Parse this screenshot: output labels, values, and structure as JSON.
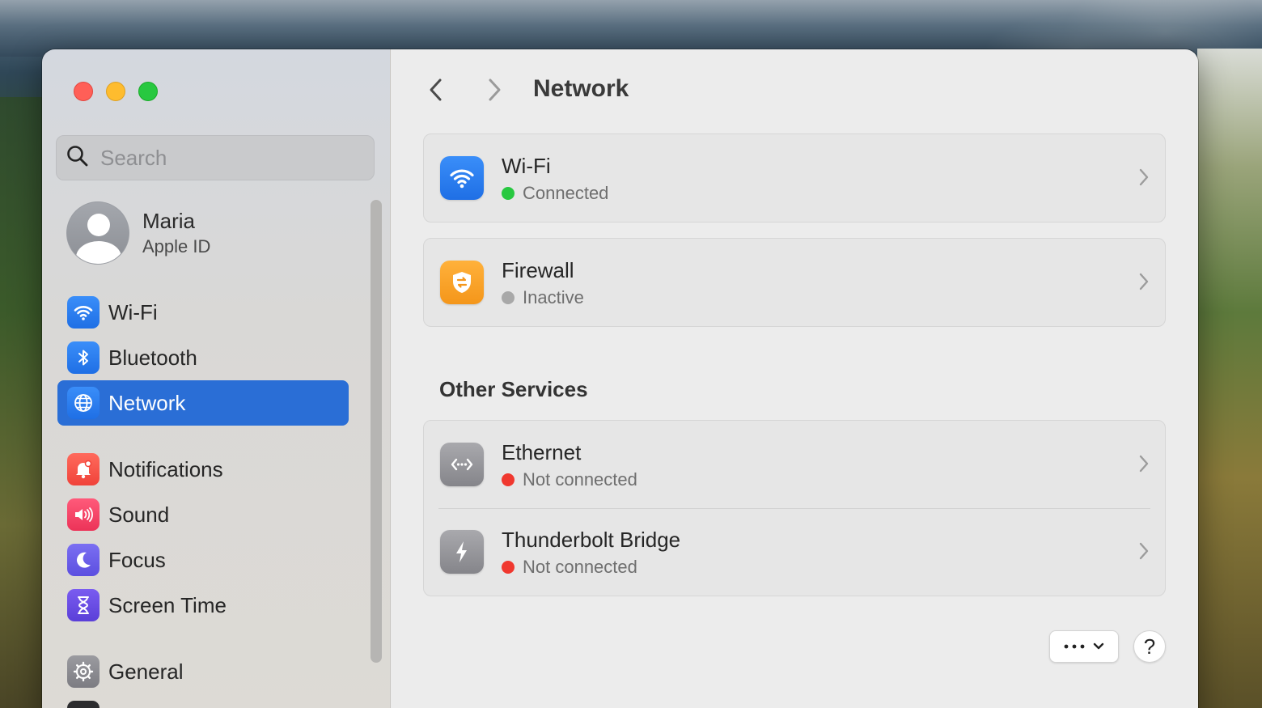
{
  "window": {
    "title": "Network"
  },
  "sidebar": {
    "search_placeholder": "Search",
    "account": {
      "name": "Maria",
      "subtitle": "Apple ID"
    },
    "items": [
      {
        "label": "Wi-Fi",
        "icon": "wifi-icon",
        "color": "#1f6fe5",
        "selected": false
      },
      {
        "label": "Bluetooth",
        "icon": "bluetooth-icon",
        "color": "#1f6fe5",
        "selected": false
      },
      {
        "label": "Network",
        "icon": "globe-icon",
        "color": "#1f6fe5",
        "selected": true
      },
      {
        "label": "Notifications",
        "icon": "bell-icon",
        "color": "#f0433a",
        "selected": false
      },
      {
        "label": "Sound",
        "icon": "speaker-icon",
        "color": "#ec3358",
        "selected": false
      },
      {
        "label": "Focus",
        "icon": "moon-icon",
        "color": "#5c4fe0",
        "selected": false
      },
      {
        "label": "Screen Time",
        "icon": "hourglass-icon",
        "color": "#5a3fd8",
        "selected": false
      },
      {
        "label": "General",
        "icon": "gear-icon",
        "color": "#7c7c82",
        "selected": false
      }
    ]
  },
  "main": {
    "services": [
      {
        "title": "Wi-Fi",
        "status": "Connected",
        "status_color": "#28c840",
        "icon": "wifi-icon"
      },
      {
        "title": "Firewall",
        "status": "Inactive",
        "status_color": "#a8a8a8",
        "icon": "shield-icon"
      }
    ],
    "other_section_title": "Other Services",
    "other_services": [
      {
        "title": "Ethernet",
        "status": "Not connected",
        "status_color": "#f0382f",
        "icon": "ethernet-icon"
      },
      {
        "title": "Thunderbolt Bridge",
        "status": "Not connected",
        "status_color": "#f0382f",
        "icon": "thunderbolt-icon"
      }
    ],
    "help_label": "?"
  },
  "colors": {
    "accent": "#2a6ed6",
    "connected": "#28c840",
    "inactive": "#a8a8a8",
    "not_connected": "#f0382f"
  }
}
